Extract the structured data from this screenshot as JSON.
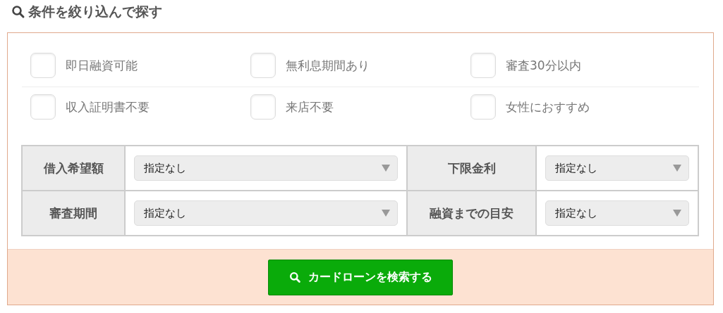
{
  "heading": "条件を絞り込んで探す",
  "checkbox_rows": [
    [
      {
        "label": "即日融資可能",
        "checked": false
      },
      {
        "label": "無利息期間あり",
        "checked": false
      },
      {
        "label": "審査30分以内",
        "checked": false
      }
    ],
    [
      {
        "label": "収入証明書不要",
        "checked": false
      },
      {
        "label": "来店不要",
        "checked": false
      },
      {
        "label": "女性におすすめ",
        "checked": false
      }
    ]
  ],
  "filter_rows": [
    [
      {
        "label": "借入希望額",
        "value": "指定なし"
      },
      {
        "label": "下限金利",
        "value": "指定なし"
      }
    ],
    [
      {
        "label": "審査期間",
        "value": "指定なし"
      },
      {
        "label": "融資までの目安",
        "value": "指定なし"
      }
    ]
  ],
  "search_button": "カードローンを検索する"
}
